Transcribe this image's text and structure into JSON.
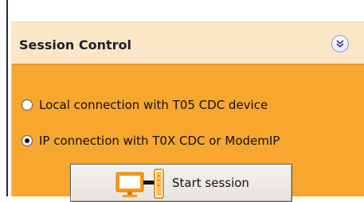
{
  "panel": {
    "title": "Session Control",
    "collapse_icon": "double-chevron-down-icon"
  },
  "options": [
    {
      "label": "Local connection with T05 CDC device",
      "selected": false
    },
    {
      "label": "IP connection with T0X CDC or ModemIP",
      "selected": true
    }
  ],
  "start_button": {
    "label": "Start session",
    "icon": "computer-to-device-connection-icon"
  },
  "colors": {
    "header_bg": "#fbe7c8",
    "body_bg": "#f7a72e",
    "button_bg": "#e6e3dc"
  }
}
